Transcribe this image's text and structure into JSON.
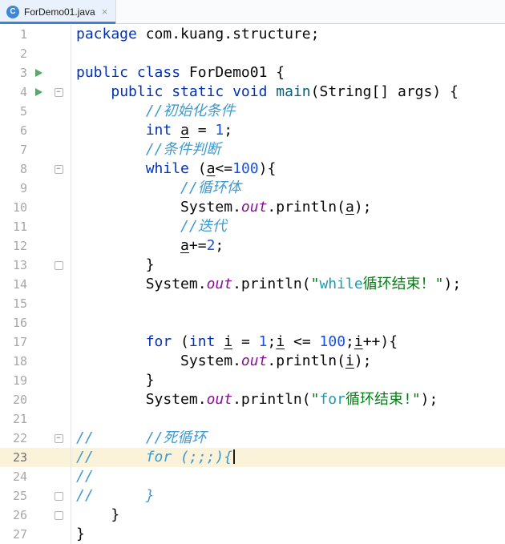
{
  "tab": {
    "title": "ForDemo01.java",
    "icon_letter": "C",
    "close_glyph": "×"
  },
  "palette": {
    "keyword": "#0033B3",
    "plain": "#080808",
    "comment": "#3D9AD0",
    "number": "#1750EB",
    "string": "#067D17",
    "string_latin": "#1A9CB0",
    "static_field": "#871094",
    "method_declaration": "#00627A",
    "run_icon_green": "#59A869",
    "current_line_bg": "#FBF2DA",
    "tab_underline": "#3B82D8",
    "line_number": "#A7A7A7"
  },
  "editor": {
    "current_line": 23,
    "lines": [
      {
        "num": 1,
        "tokens": [
          {
            "c": "kw",
            "t": "package"
          },
          {
            "c": "pl",
            "t": " com.kuang.structure;"
          }
        ]
      },
      {
        "num": 2,
        "tokens": []
      },
      {
        "num": 3,
        "run": true,
        "tokens": [
          {
            "c": "kw",
            "t": "public class"
          },
          {
            "c": "pl",
            "t": " ForDemo01 {"
          }
        ]
      },
      {
        "num": 4,
        "run": true,
        "fold": "start",
        "tokens": [
          {
            "c": "pl",
            "t": "    "
          },
          {
            "c": "kw",
            "t": "public static void"
          },
          {
            "c": "pl",
            "t": " "
          },
          {
            "c": "mth",
            "t": "main"
          },
          {
            "c": "pl",
            "t": "(String[] args) {"
          }
        ]
      },
      {
        "num": 5,
        "tokens": [
          {
            "c": "pl",
            "t": "        "
          },
          {
            "c": "cm",
            "t": "//初始化条件"
          }
        ]
      },
      {
        "num": 6,
        "tokens": [
          {
            "c": "pl",
            "t": "        "
          },
          {
            "c": "kw",
            "t": "int"
          },
          {
            "c": "pl",
            "t": " "
          },
          {
            "c": "var",
            "t": "a"
          },
          {
            "c": "pl",
            "t": " = "
          },
          {
            "c": "num",
            "t": "1"
          },
          {
            "c": "pl",
            "t": ";"
          }
        ]
      },
      {
        "num": 7,
        "tokens": [
          {
            "c": "pl",
            "t": "        "
          },
          {
            "c": "cm",
            "t": "//条件判断"
          }
        ]
      },
      {
        "num": 8,
        "fold": "start",
        "tokens": [
          {
            "c": "pl",
            "t": "        "
          },
          {
            "c": "kw",
            "t": "while"
          },
          {
            "c": "pl",
            "t": " ("
          },
          {
            "c": "var",
            "t": "a"
          },
          {
            "c": "pl",
            "t": "<="
          },
          {
            "c": "num",
            "t": "100"
          },
          {
            "c": "pl",
            "t": "){"
          }
        ]
      },
      {
        "num": 9,
        "tokens": [
          {
            "c": "pl",
            "t": "            "
          },
          {
            "c": "cm",
            "t": "//循环体"
          }
        ]
      },
      {
        "num": 10,
        "tokens": [
          {
            "c": "pl",
            "t": "            System."
          },
          {
            "c": "fld",
            "t": "out"
          },
          {
            "c": "pl",
            "t": ".println("
          },
          {
            "c": "var",
            "t": "a"
          },
          {
            "c": "pl",
            "t": ");"
          }
        ]
      },
      {
        "num": 11,
        "tokens": [
          {
            "c": "pl",
            "t": "            "
          },
          {
            "c": "cm",
            "t": "//迭代"
          }
        ]
      },
      {
        "num": 12,
        "tokens": [
          {
            "c": "pl",
            "t": "            "
          },
          {
            "c": "var",
            "t": "a"
          },
          {
            "c": "pl",
            "t": "+="
          },
          {
            "c": "num",
            "t": "2"
          },
          {
            "c": "pl",
            "t": ";"
          }
        ]
      },
      {
        "num": 13,
        "fold": "end",
        "tokens": [
          {
            "c": "pl",
            "t": "        }"
          }
        ]
      },
      {
        "num": 14,
        "tokens": [
          {
            "c": "pl",
            "t": "        System."
          },
          {
            "c": "fld",
            "t": "out"
          },
          {
            "c": "pl",
            "t": ".println("
          },
          {
            "c": "str",
            "t": "\""
          },
          {
            "c": "strl",
            "t": "while"
          },
          {
            "c": "str",
            "t": "循环结束！\""
          },
          {
            "c": "pl",
            "t": ");"
          }
        ]
      },
      {
        "num": 15,
        "tokens": []
      },
      {
        "num": 16,
        "tokens": []
      },
      {
        "num": 17,
        "tokens": [
          {
            "c": "pl",
            "t": "        "
          },
          {
            "c": "kw",
            "t": "for"
          },
          {
            "c": "pl",
            "t": " ("
          },
          {
            "c": "kw",
            "t": "int"
          },
          {
            "c": "pl",
            "t": " "
          },
          {
            "c": "var",
            "t": "i"
          },
          {
            "c": "pl",
            "t": " = "
          },
          {
            "c": "num",
            "t": "1"
          },
          {
            "c": "pl",
            "t": ";"
          },
          {
            "c": "var",
            "t": "i"
          },
          {
            "c": "pl",
            "t": " <= "
          },
          {
            "c": "num",
            "t": "100"
          },
          {
            "c": "pl",
            "t": ";"
          },
          {
            "c": "var",
            "t": "i"
          },
          {
            "c": "pl",
            "t": "++){"
          }
        ]
      },
      {
        "num": 18,
        "tokens": [
          {
            "c": "pl",
            "t": "            System."
          },
          {
            "c": "fld",
            "t": "out"
          },
          {
            "c": "pl",
            "t": ".println("
          },
          {
            "c": "var",
            "t": "i"
          },
          {
            "c": "pl",
            "t": ");"
          }
        ]
      },
      {
        "num": 19,
        "tokens": [
          {
            "c": "pl",
            "t": "        }"
          }
        ]
      },
      {
        "num": 20,
        "tokens": [
          {
            "c": "pl",
            "t": "        System."
          },
          {
            "c": "fld",
            "t": "out"
          },
          {
            "c": "pl",
            "t": ".println("
          },
          {
            "c": "str",
            "t": "\""
          },
          {
            "c": "strl",
            "t": "for"
          },
          {
            "c": "str",
            "t": "循环结束!\""
          },
          {
            "c": "pl",
            "t": ");"
          }
        ]
      },
      {
        "num": 21,
        "tokens": []
      },
      {
        "num": 22,
        "fold": "start",
        "tokens": [
          {
            "c": "cm",
            "t": "//      //死循环"
          }
        ]
      },
      {
        "num": 23,
        "current": true,
        "caret": true,
        "tokens": [
          {
            "c": "cm",
            "t": "//      for (;;;){"
          }
        ]
      },
      {
        "num": 24,
        "tokens": [
          {
            "c": "cm",
            "t": "//"
          }
        ]
      },
      {
        "num": 25,
        "fold": "end",
        "tokens": [
          {
            "c": "cm",
            "t": "//      }"
          }
        ]
      },
      {
        "num": 26,
        "fold": "end",
        "tokens": [
          {
            "c": "pl",
            "t": "    }"
          }
        ]
      },
      {
        "num": 27,
        "tokens": [
          {
            "c": "pl",
            "t": "}"
          }
        ]
      }
    ]
  }
}
